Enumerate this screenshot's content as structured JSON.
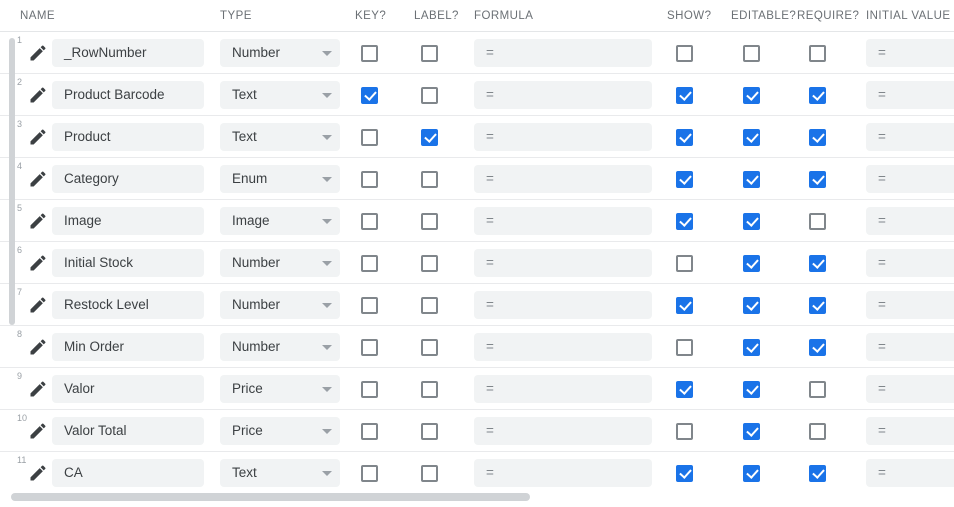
{
  "columns": {
    "name": "NAME",
    "type": "TYPE",
    "key": "KEY?",
    "label": "LABEL?",
    "formula": "FORMULA",
    "show": "SHOW?",
    "editable": "EDITABLE?",
    "require": "REQUIRE?",
    "initial_value": "INITIAL VALUE"
  },
  "field_placeholders": {
    "formula": "=",
    "initial_value": "="
  },
  "colors": {
    "checkbox_checked": "#1a73e8",
    "checkbox_border": "#80868b",
    "field_background": "#f1f3f4",
    "header_text": "#6b7075",
    "row_divider": "#e9eaec",
    "scrollbar_thumb": "#d0d3d6"
  },
  "icons": {
    "edit": "pencil-icon",
    "dropdown": "chevron-down-icon"
  },
  "rows": [
    {
      "num": "1",
      "name": "_RowNumber",
      "type": "Number",
      "key": false,
      "label": false,
      "formula": "=",
      "show": false,
      "editable": false,
      "require": false,
      "initial": "="
    },
    {
      "num": "2",
      "name": "Product Barcode",
      "type": "Text",
      "key": true,
      "label": false,
      "formula": "=",
      "show": true,
      "editable": true,
      "require": true,
      "initial": "="
    },
    {
      "num": "3",
      "name": "Product",
      "type": "Text",
      "key": false,
      "label": true,
      "formula": "=",
      "show": true,
      "editable": true,
      "require": true,
      "initial": "="
    },
    {
      "num": "4",
      "name": "Category",
      "type": "Enum",
      "key": false,
      "label": false,
      "formula": "=",
      "show": true,
      "editable": true,
      "require": true,
      "initial": "="
    },
    {
      "num": "5",
      "name": "Image",
      "type": "Image",
      "key": false,
      "label": false,
      "formula": "=",
      "show": true,
      "editable": true,
      "require": false,
      "initial": "="
    },
    {
      "num": "6",
      "name": "Initial Stock",
      "type": "Number",
      "key": false,
      "label": false,
      "formula": "=",
      "show": false,
      "editable": true,
      "require": true,
      "initial": "="
    },
    {
      "num": "7",
      "name": "Restock Level",
      "type": "Number",
      "key": false,
      "label": false,
      "formula": "=",
      "show": true,
      "editable": true,
      "require": true,
      "initial": "="
    },
    {
      "num": "8",
      "name": "Min Order",
      "type": "Number",
      "key": false,
      "label": false,
      "formula": "=",
      "show": false,
      "editable": true,
      "require": true,
      "initial": "="
    },
    {
      "num": "9",
      "name": "Valor",
      "type": "Price",
      "key": false,
      "label": false,
      "formula": "=",
      "show": true,
      "editable": true,
      "require": false,
      "initial": "="
    },
    {
      "num": "10",
      "name": "Valor Total",
      "type": "Price",
      "key": false,
      "label": false,
      "formula": "=",
      "show": false,
      "editable": true,
      "require": false,
      "initial": "="
    },
    {
      "num": "11",
      "name": "CA",
      "type": "Text",
      "key": false,
      "label": false,
      "formula": "=",
      "show": true,
      "editable": true,
      "require": true,
      "initial": "="
    }
  ]
}
